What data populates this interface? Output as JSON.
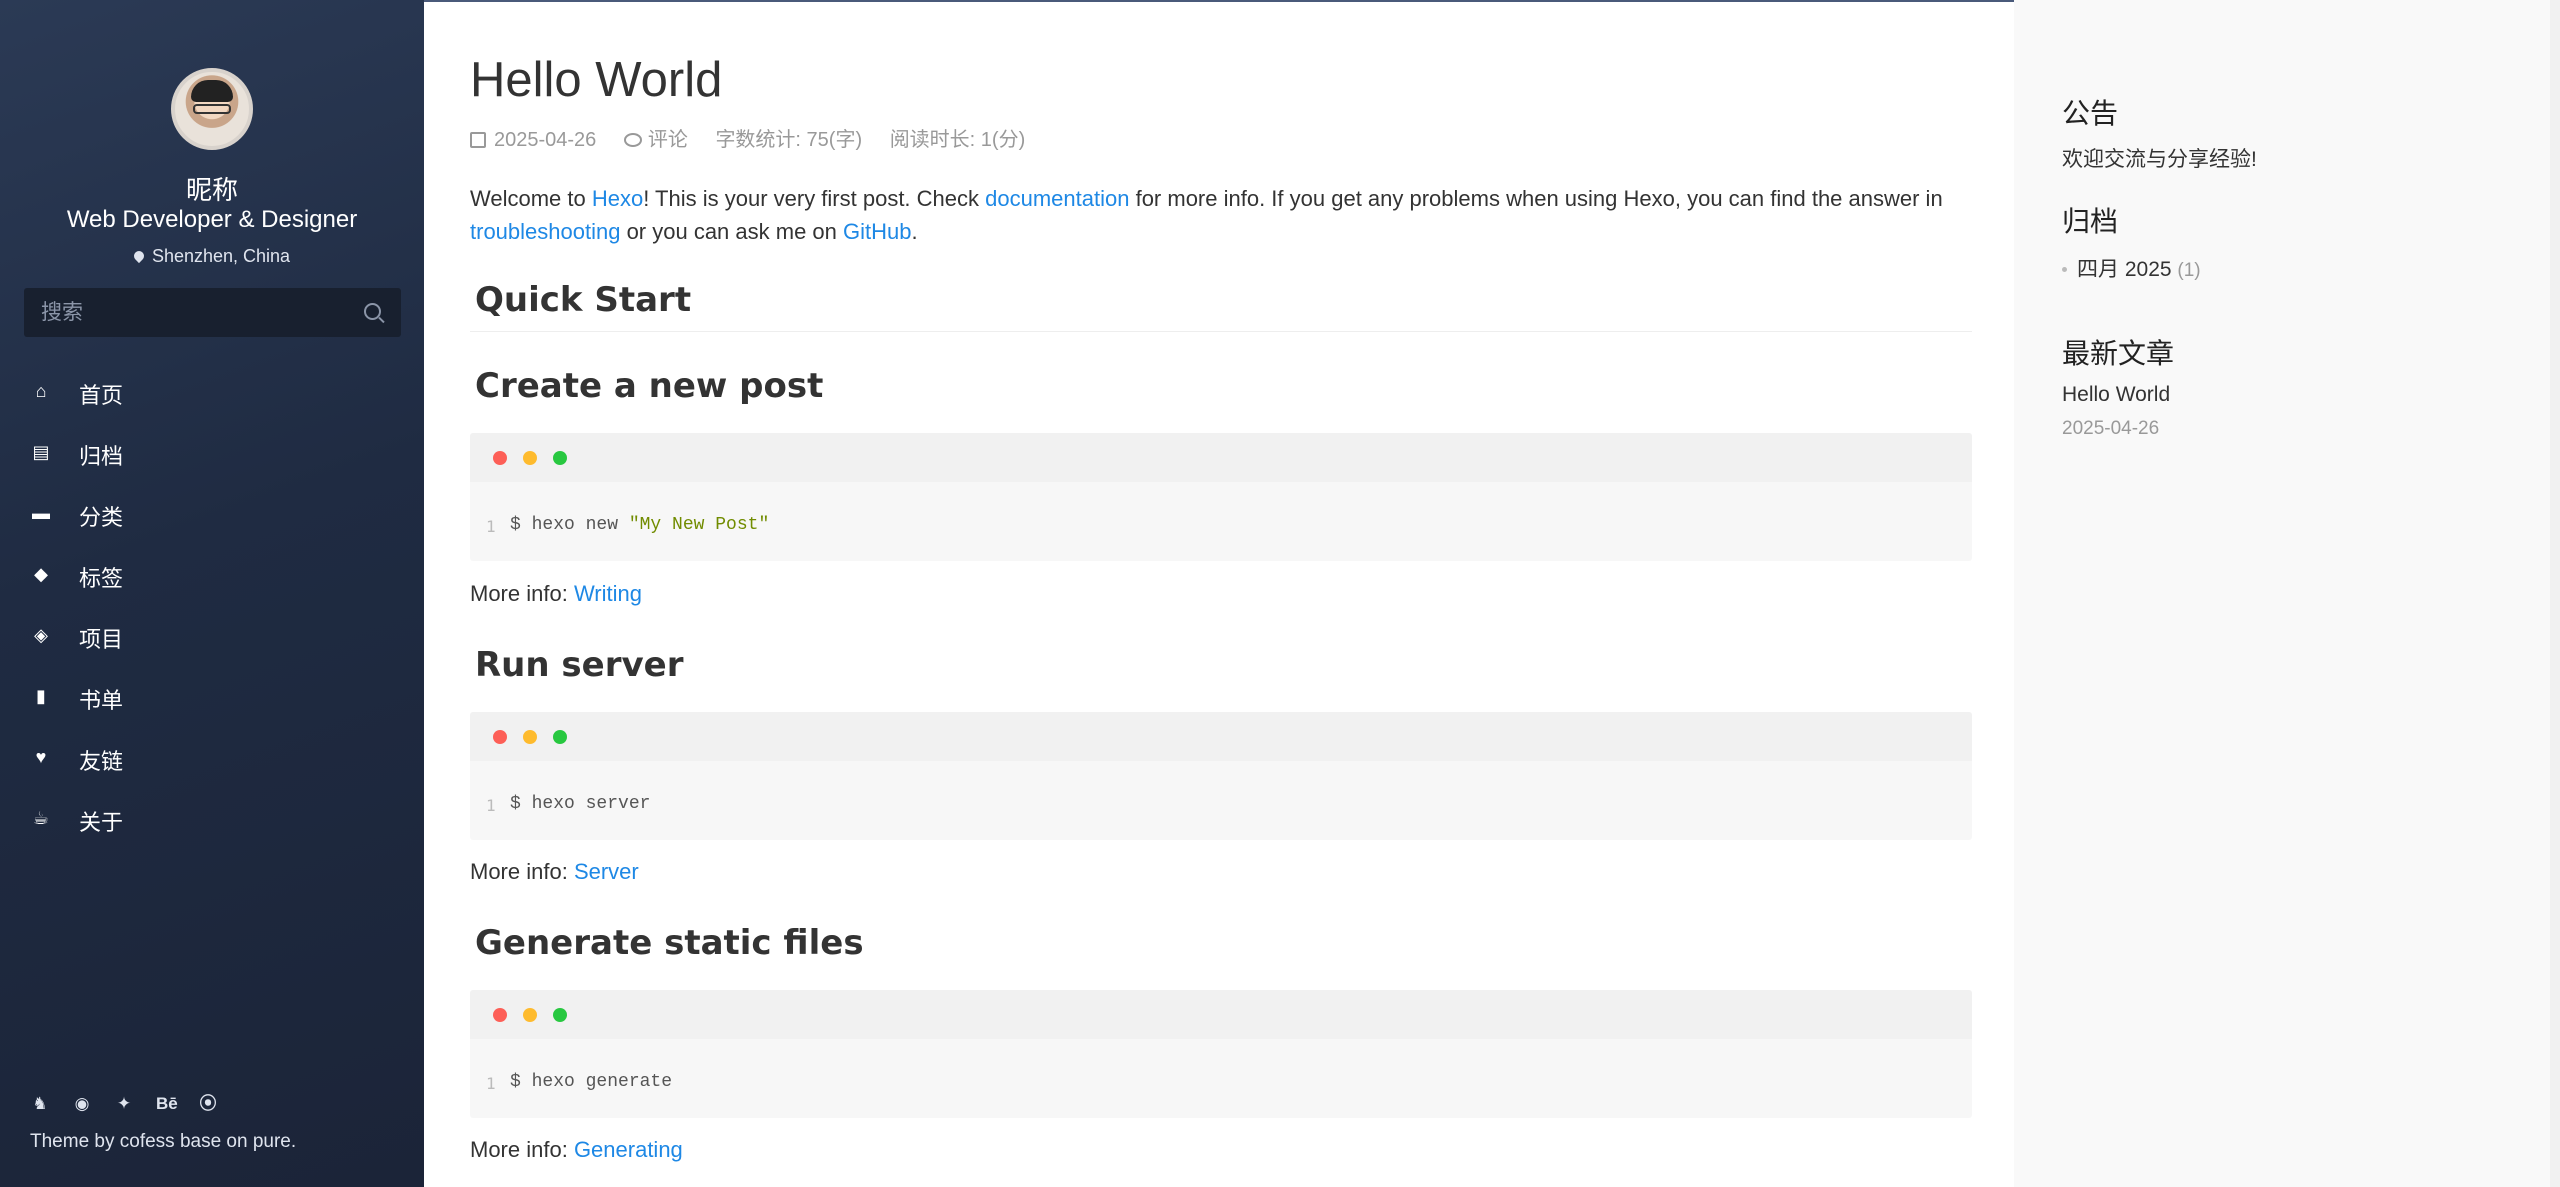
{
  "sidebar": {
    "nickname": "昵称",
    "role": "Web Developer & Designer",
    "location": "Shenzhen, China",
    "search_placeholder": "搜索",
    "nav": [
      {
        "label": "首页",
        "icon": "home-icon"
      },
      {
        "label": "归档",
        "icon": "archive-icon"
      },
      {
        "label": "分类",
        "icon": "folder-icon"
      },
      {
        "label": "标签",
        "icon": "tags-icon"
      },
      {
        "label": "项目",
        "icon": "layers-icon"
      },
      {
        "label": "书单",
        "icon": "book-icon"
      },
      {
        "label": "友链",
        "icon": "heart-icon"
      },
      {
        "label": "关于",
        "icon": "coffee-icon"
      }
    ],
    "social": [
      "github-icon",
      "weibo-icon",
      "twitter-icon",
      "behance-icon",
      "rss-icon"
    ],
    "credit": "Theme by cofess base on pure."
  },
  "post": {
    "title": "Hello World",
    "date": "2025-04-26",
    "comments": "评论",
    "word_count": "字数统计: 75(字)",
    "read_time": "阅读时长: 1(分)",
    "intro": {
      "t1": "Welcome to ",
      "hexo": "Hexo",
      "t2": "! This is your very first post. Check ",
      "documentation": "documentation",
      "t3": " for more info. If you get any problems when using Hexo, you can find the answer in ",
      "troubleshooting": "troubleshooting",
      "t4": " or you can ask me on ",
      "github": "GitHub",
      "t5": "."
    },
    "sections": [
      {
        "heading": "Quick Start"
      },
      {
        "heading": "Create a new post",
        "line": "1",
        "cmd": "$ hexo new ",
        "str": "\"My New Post\"",
        "more_label": "More info: ",
        "more_link": "Writing"
      },
      {
        "heading": "Run server",
        "line": "1",
        "cmd": "$ hexo server",
        "more_label": "More info: ",
        "more_link": "Server"
      },
      {
        "heading": "Generate static files",
        "line": "1",
        "cmd": "$ hexo generate",
        "more_label": "More info: ",
        "more_link": "Generating"
      }
    ]
  },
  "widgets": {
    "notice_title": "公告",
    "notice_text": "欢迎交流与分享经验!",
    "archive_title": "归档",
    "archive_item": "四月 2025",
    "archive_count": "(1)",
    "recent_title": "最新文章",
    "recent_post": "Hello World",
    "recent_date": "2025-04-26"
  }
}
